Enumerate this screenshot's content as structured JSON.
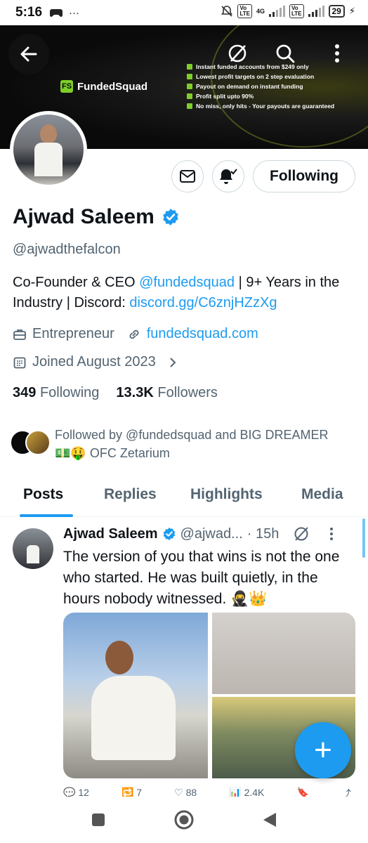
{
  "status_bar": {
    "time": "5:16",
    "battery": "29"
  },
  "banner": {
    "brand": "FundedSquad",
    "logo_text": "FS",
    "features": [
      "Instant funded accounts from $249 only",
      "Lowest profit targets on 2 step evaluation",
      "Payout on demand on instant funding",
      "Profit split upto 90%",
      "No miss, only hits - Your payouts are guaranteed"
    ]
  },
  "profile": {
    "name": "Ajwad Saleem",
    "handle": "@ajwadthefalcon",
    "bio_prefix": "Co-Founder & CEO ",
    "bio_mention": "@fundedsquad",
    "bio_middle": " | 9+ Years in the Industry |  Discord: ",
    "bio_link": "discord.gg/C6znjHZzXg",
    "category": "Entrepreneur",
    "website": "fundedsquad.com",
    "joined": "Joined August 2023",
    "following_count": "349",
    "following_label": "Following",
    "followers_count": "13.3K",
    "followers_label": "Followers",
    "followed_by_line1": "Followed by @fundedsquad and BIG DREAMER",
    "followed_by_line2": "💵🤑 OFC Zetarium"
  },
  "buttons": {
    "follow": "Following"
  },
  "tabs": [
    "Posts",
    "Replies",
    "Highlights",
    "Media"
  ],
  "post": {
    "name": "Ajwad Saleem",
    "handle": "@ajwad...",
    "time": "· 15h",
    "text": "The version of you that wins is not the one who started. He was built quietly, in the hours nobody witnessed. 🥷👑",
    "stats": [
      "12",
      "7",
      "88",
      "2.4K"
    ]
  },
  "fab": "+",
  "colors": {
    "accent": "#1d9bf0",
    "brand_green": "#7ecf2a"
  }
}
